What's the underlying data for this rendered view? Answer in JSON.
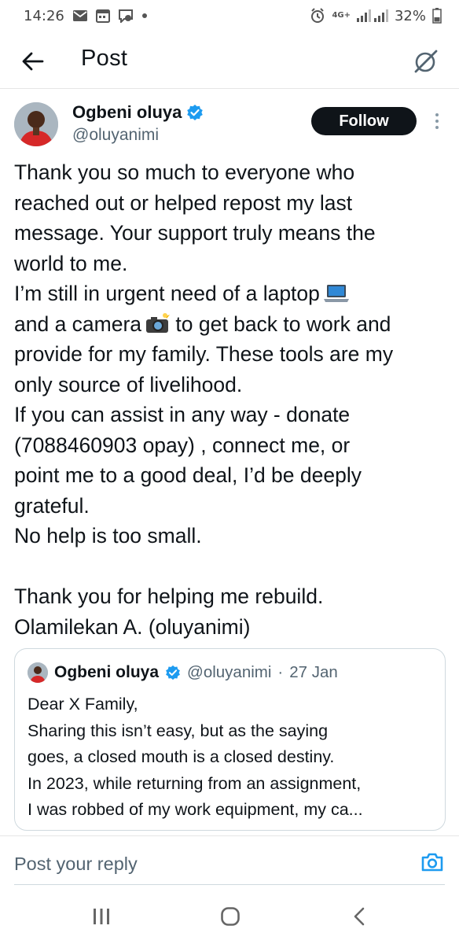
{
  "status_bar": {
    "time": "14:26",
    "network": "4G+",
    "battery": "32%",
    "icons": [
      "mail-icon",
      "calendar-icon",
      "messenger-icon",
      "dot-icon",
      "alarm-icon",
      "signal-icon",
      "battery-icon"
    ]
  },
  "header": {
    "title": "Post",
    "back_icon": "back-arrow-icon",
    "grok_icon": "grok-icon"
  },
  "post": {
    "author_name": "Ogbeni oluya",
    "verified": true,
    "handle": "@oluyanimi",
    "follow_label": "Follow",
    "lines": [
      "Thank you so much to everyone who",
      "reached out or helped repost my last",
      "message. Your support truly means the",
      "world to me.",
      "I’m still in urgent need of a laptop",
      "and a camera",
      "to get back to work and",
      "provide for my family. These tools are my",
      "only source of livelihood.",
      "If you can assist in any way - donate",
      "(7088460903 opay) , connect me, or",
      "point me to a good deal, I’d be deeply",
      "grateful.",
      "No help is too small.",
      "Thank you for helping me rebuild.",
      "Olamilekan A. (oluyanimi)"
    ],
    "emojis": {
      "laptop": "💻",
      "camera": "📸"
    }
  },
  "quote": {
    "author_name": "Ogbeni oluya",
    "verified": true,
    "handle": "@oluyanimi",
    "separator": "·",
    "date": "27 Jan",
    "lines": [
      "Dear X Family,",
      "Sharing this isn’t easy, but as the saying",
      "goes, a closed mouth is a closed destiny.",
      "In 2023, while returning from an assignment,",
      "I was robbed of my work equipment, my ca..."
    ]
  },
  "reply": {
    "placeholder": "Post your reply",
    "camera_icon": "camera-icon"
  },
  "nav": {
    "icons": [
      "recents-icon",
      "home-icon",
      "back-icon"
    ]
  },
  "colors": {
    "text": "#0f1419",
    "secondary": "#536471",
    "verified": "#1d9bf0",
    "camera_accent": "#1d9bf0",
    "follow_bg": "#0f1419"
  }
}
